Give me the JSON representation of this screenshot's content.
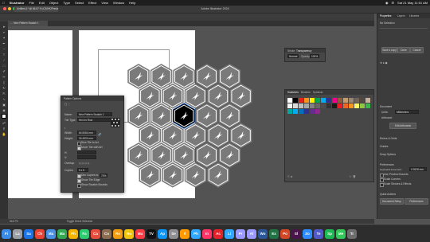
{
  "menubar": {
    "apple": "",
    "app": "Illustrator",
    "items": [
      "File",
      "Edit",
      "Object",
      "Type",
      "Select",
      "Effect",
      "View",
      "Window",
      "Help"
    ],
    "clock": "Sat 21 May 11:51 AM"
  },
  "window": {
    "title": "Adobe Illustrator 2024",
    "doc_tab": "Untitled-1* @ 66.67 % (CMYK/Preview)",
    "active_tab": "New Pattern Swatch 1"
  },
  "pattern_options": {
    "title": "Pattern Options",
    "name_label": "Name:",
    "name_value": "New Pattern Swatch 1",
    "tile_type_label": "Tile Type:",
    "tile_type_value": "Hex by Row",
    "width_label": "Width:",
    "width_value": "64.5064 mm",
    "height_label": "Height:",
    "height_value": "34.4924 mm",
    "size_tile_label": "Size Tile to Art",
    "move_tile_label": "Move Tile with Art",
    "overlap_label": "Overlap:",
    "copies_label": "Copies:",
    "copies_value": "5 x 5",
    "dim_copies_label": "Dim Copies to:",
    "dim_copies_value": "70%",
    "show_tile_edge_label": "Show Tile Edge",
    "show_swatch_bounds_label": "Show Swatch Bounds"
  },
  "transparency": {
    "tab": "Stroke",
    "tab2": "Transparency",
    "mode": "Normal",
    "opacity_label": "Opacity:",
    "opacity_value": "100%"
  },
  "swatches": {
    "tabs": [
      "Swatches",
      "Brushes",
      "Symbols"
    ],
    "colors": [
      "#ffffff",
      "#000000",
      "#e2231a",
      "#f7941d",
      "#fff200",
      "#00a651",
      "#00aeef",
      "#2e3192",
      "#ec008c",
      "#8b5e3c",
      "#c69c6d",
      "#998675",
      "#736357",
      "#534741",
      "#c7b299",
      "#f2f2f2",
      "#d9d9d9",
      "#bfbfbf",
      "#a6a6a6",
      "#808080",
      "#666666",
      "#4d4d4d",
      "#333333",
      "#1a1a1a",
      "#ed1c24",
      "#f26522",
      "#f7941d",
      "#fff568",
      "#8dc63f",
      "#39b54a",
      "#00a99d",
      "#00aeef",
      "#0072bc",
      "#2e3192",
      "#662d91",
      "#92278f"
    ]
  },
  "properties": {
    "tabs": [
      "Properties",
      "Layers",
      "Libraries"
    ],
    "section": "No Selection",
    "doc_label": "Document",
    "units_label": "Units:",
    "units_value": "Millimeters",
    "artboard_label": "Artboard:",
    "edit_artboards": "Edit Artboards",
    "rulers_label": "Rulers & Grids",
    "guides_label": "Guides",
    "snap_label": "Snap Options",
    "preferences_label": "Preferences",
    "keyboard_increment_label": "Keyboard Increment:",
    "keyboard_increment_value": "0.3528 mm",
    "use_preview_bounds": "Use Preview Bounds",
    "scale_corners": "Scale Corners",
    "scale_strokes": "Scale Strokes & Effects",
    "quick_actions": "Quick Actions",
    "document_setup": "Document Setup",
    "preferences_btn": "Preferences",
    "save_pattern": "Save a copy",
    "done": "Done",
    "cancel": "Cancel"
  },
  "statusbar": {
    "zoom": "66.67%",
    "tool": "Toggle Direct Selection"
  },
  "dock": [
    "Finder",
    "Launchpad",
    "Safari",
    "Chrome",
    "Mail",
    "Maps",
    "Photos",
    "FaceTime",
    "Calendar",
    "Contacts",
    "Reminders",
    "Notes",
    "Music",
    "TV",
    "App Store",
    "Settings",
    "Illustrator",
    "Photoshop",
    "InDesign",
    "Acrobat",
    "Lightroom",
    "Premiere",
    "After Effects",
    "Word",
    "Excel",
    "PowerPoint",
    "Slack",
    "Zoom",
    "Teams",
    "Spotify",
    "Messages",
    "Trash"
  ]
}
